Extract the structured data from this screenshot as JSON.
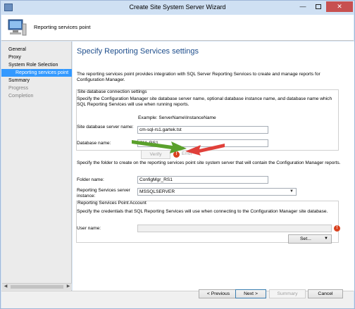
{
  "window": {
    "title": "Create Site System Server Wizard",
    "minimize_glyph": "—",
    "maximize_glyph": "",
    "close_glyph": "✕"
  },
  "header": {
    "title": "Reporting services point",
    "icon": "server-computer-icon"
  },
  "nav": {
    "items": [
      {
        "label": "General",
        "state": "normal"
      },
      {
        "label": "Proxy",
        "state": "normal"
      },
      {
        "label": "System Role Selection",
        "state": "normal"
      },
      {
        "label": "Reporting services point",
        "state": "active"
      },
      {
        "label": "Summary",
        "state": "normal"
      },
      {
        "label": "Progress",
        "state": "disabled"
      },
      {
        "label": "Completion",
        "state": "disabled"
      }
    ],
    "scroll_left": "◀",
    "scroll_right": "▶"
  },
  "main": {
    "page_title": "Specify Reporting Services settings",
    "intro": "The reporting services point provides integration with SQL Server Reporting Services to create and manage reports for Configuration Manager.",
    "db_group": {
      "title": "Site database connection settings",
      "description": "Specify the Configuration Manager site database server name, optional database instance name, and database name which SQL Reporting Services will use when running reports.",
      "example": "Example: ServerName\\InstanceName",
      "server_label": "Site database server name:",
      "server_value": "cm-sql-rs1.gartek.tst",
      "database_label": "Database name:",
      "database_value": "CM_RS1",
      "verify_label": "Verify",
      "error_text": "Error"
    },
    "folder_description": "Specify the folder to create on the reporting services point site system server that will contain the Configuration Manager reports.",
    "folder_label": "Folder name:",
    "folder_value": "ConfigMgr_RS1",
    "instance_label": "Reporting Services server instance:",
    "instance_value": "MSSQLSERVER",
    "account_group": {
      "title": "Reporting Services Point Account",
      "description": "Specify the credentials that SQL Reporting Services will use when connecting to the Configuration Manager site database.",
      "user_label": "User name:",
      "user_value": "",
      "set_label": "Set..."
    }
  },
  "footer": {
    "previous_label": "< Previous",
    "next_label": "Next >",
    "summary_label": "Summary",
    "cancel_label": "Cancel"
  },
  "colors": {
    "accent": "#3399ff",
    "page_title": "#1e4e8c",
    "error": "#d9411e",
    "arrow_green": "#5aa02c",
    "arrow_red": "#e0403a"
  }
}
